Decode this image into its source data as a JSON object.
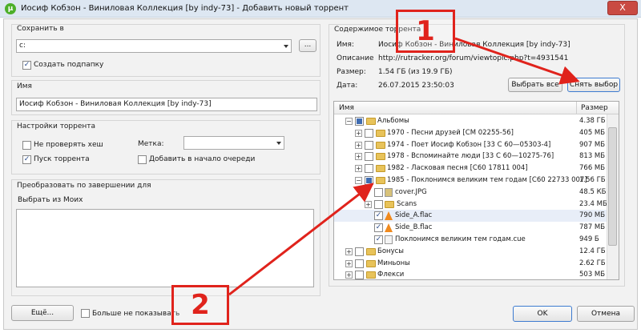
{
  "window": {
    "title": "Иосиф Кобзон - Виниловая Коллекция [by indy-73] - Добавить новый торрент",
    "close": "X"
  },
  "save": {
    "section_label": "Сохранить в",
    "path": "c:",
    "browse": "...",
    "create_subfolder": "Создать подпапку"
  },
  "name": {
    "section_label": "Имя",
    "value": "Иосиф Кобзон - Виниловая Коллекция [by indy-73]"
  },
  "settings": {
    "section_label": "Настройки торрента",
    "no_hash_check": "Не проверять хеш",
    "start_torrent": "Пуск торрента",
    "label_label": "Метка:",
    "label_value": "",
    "add_top_queue": "Добавить в начало очереди"
  },
  "convert": {
    "section_label": "Преобразовать по завершении для",
    "subtitle": "Выбрать из Моих"
  },
  "footer": {
    "more": "Ещё...",
    "no_show": "Больше не показывать",
    "ok": "OK",
    "cancel": "Отмена"
  },
  "content": {
    "section_label": "Содержимое торрента",
    "name_label": "Имя:",
    "name_value": "Иосиф Кобзон - Виниловая Коллекция [by indy-73]",
    "desc_label": "Описание",
    "desc_value": "http://rutracker.org/forum/viewtopic.php?t=4931541",
    "size_label": "Размер:",
    "size_value": "1.54 ГБ (из 19.9 ГБ)",
    "date_label": "Дата:",
    "date_value": "26.07.2015 23:50:03",
    "select_all": "Выбрать все",
    "deselect": "Снять выбор"
  },
  "tree": {
    "col_name": "Имя",
    "col_size": "Размер",
    "rows": [
      {
        "name": "Альбомы",
        "size": "4.38 ГБ"
      },
      {
        "name": "1970 - Песни друзей [СМ 02255-56]",
        "size": "405 МБ"
      },
      {
        "name": "1974 - Поет Иосиф Кобзон [33 С 60—05303-4]",
        "size": "907 МБ"
      },
      {
        "name": "1978 - Вспоминайте люди [33 С 60—10275-76]",
        "size": "813 МБ"
      },
      {
        "name": "1982 - Ласковая песня [С60 17811 004]",
        "size": "766 МБ"
      },
      {
        "name": "1985 - Поклонимся великим тем годам [С60 22733 007]",
        "size": "1.56 ГБ"
      },
      {
        "name": "cover.JPG",
        "size": "48.5 КБ"
      },
      {
        "name": "Scans",
        "size": "23.4 МБ"
      },
      {
        "name": "Side_A.flac",
        "size": "790 МБ"
      },
      {
        "name": "Side_B.flac",
        "size": "787 МБ"
      },
      {
        "name": "Поклонимся великим тем годам.cue",
        "size": "949 Б"
      },
      {
        "name": "Бонусы",
        "size": "12.4 ГБ"
      },
      {
        "name": "Миньоны",
        "size": "2.62 ГБ"
      },
      {
        "name": "Флекси",
        "size": "503 МБ"
      }
    ]
  },
  "annotations": {
    "one": "1",
    "two": "2"
  },
  "icons": {
    "check": "✓",
    "plus": "+",
    "minus": "−"
  }
}
